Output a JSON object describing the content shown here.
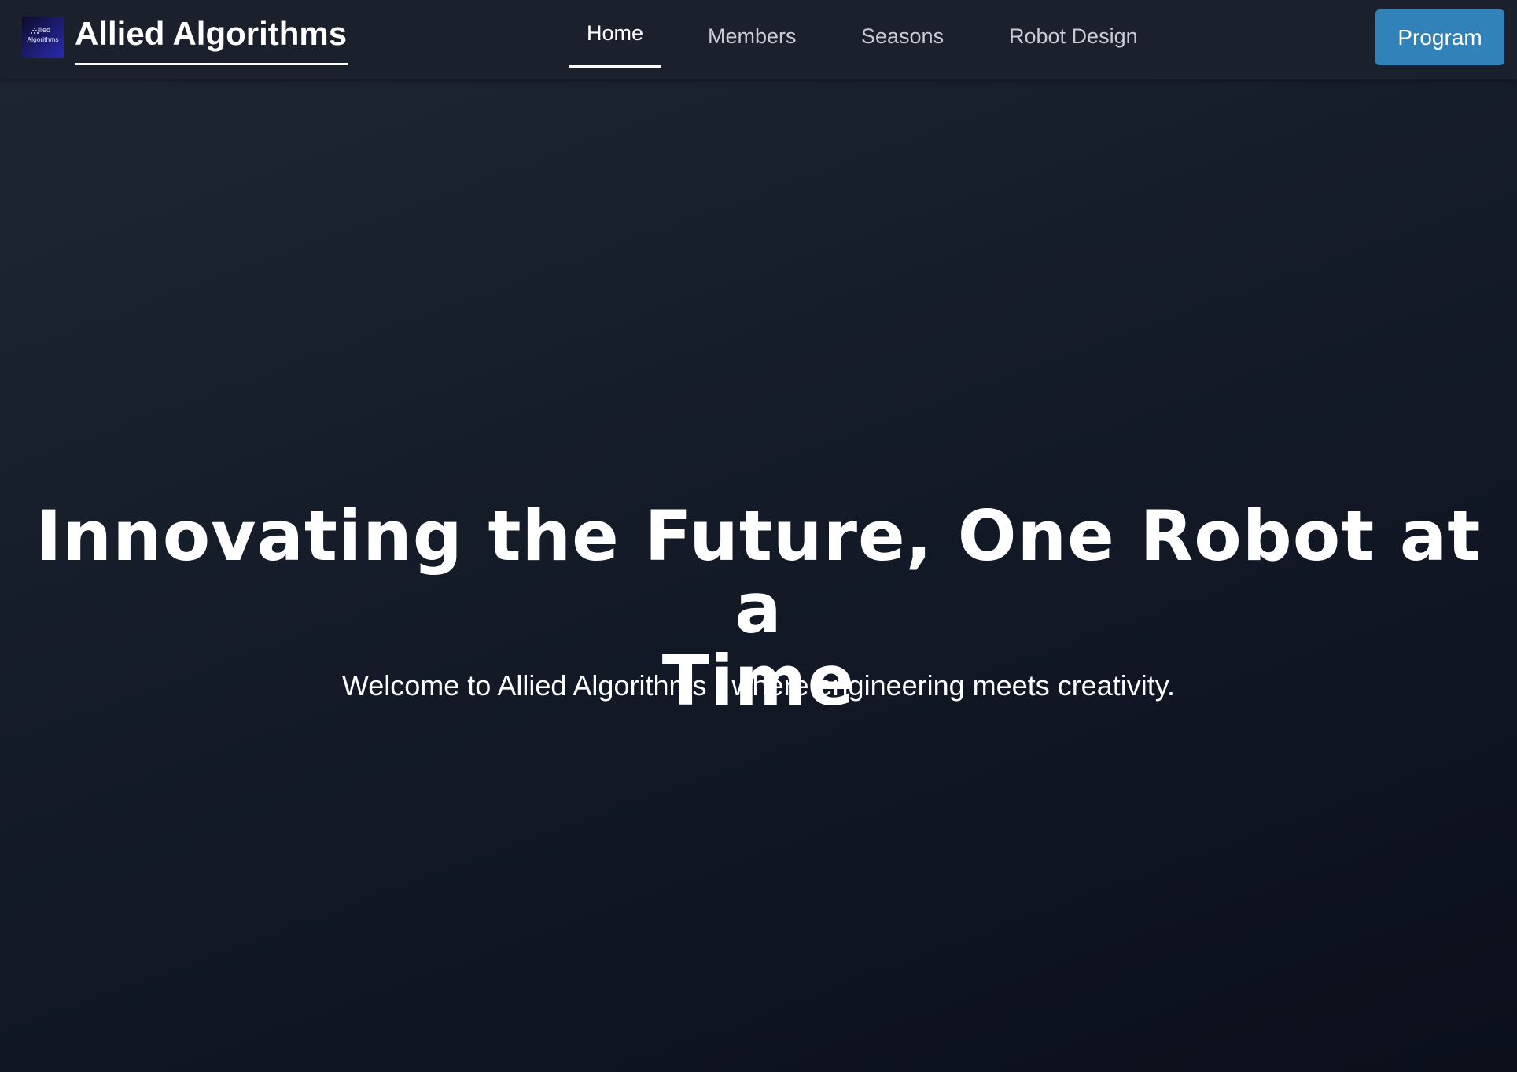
{
  "nav": {
    "logo_text_line1": "llied",
    "logo_text_line2": "Algorithms",
    "brand": "Allied Algorithms",
    "items": [
      {
        "label": "Home",
        "active": true
      },
      {
        "label": "Members",
        "active": false
      },
      {
        "label": "Seasons",
        "active": false
      },
      {
        "label": "Robot Design",
        "active": false
      }
    ],
    "cta_label": "Program"
  },
  "hero": {
    "title_line1": "Innovating the Future, One Robot at a",
    "title_line2": "Time",
    "subtitle": "Welcome to Allied Algorithms - where engineering meets creativity."
  },
  "colors": {
    "navbar_bg": "#1a202c",
    "cta_bg": "#3182b8",
    "text": "#ffffff",
    "nav_text": "#c8ccd3"
  }
}
